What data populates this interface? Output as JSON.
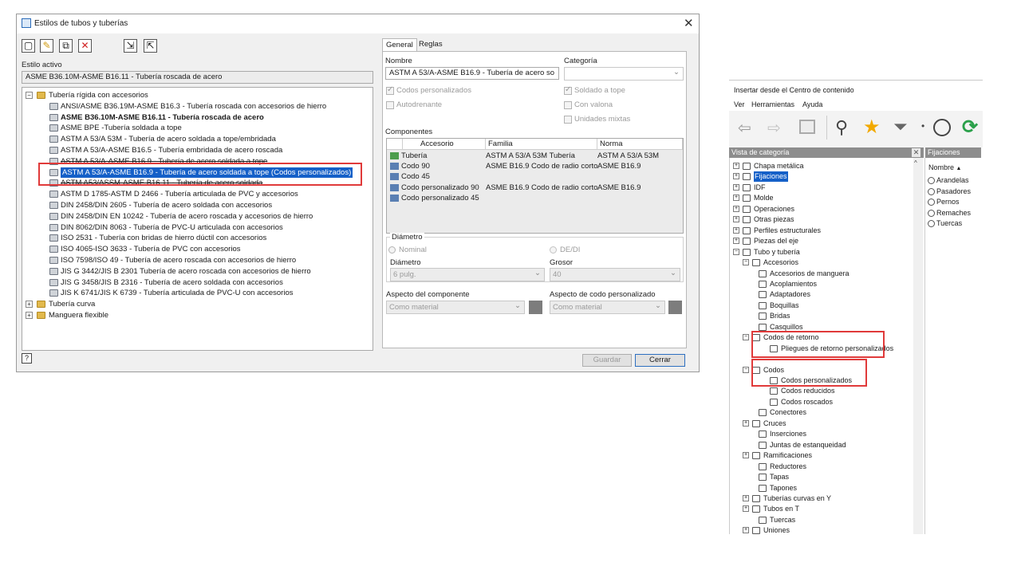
{
  "dialog": {
    "title": "Estilos de tubos y tuberías",
    "close": "✕",
    "toolbar_icons": [
      "new-icon",
      "edit-icon",
      "copy-icon",
      "delete-icon",
      "import-icon",
      "export-icon"
    ],
    "active_style_label": "Estilo activo",
    "active_style_value": "ASME B36.10M-ASME B16.11 - Tubería roscada de acero",
    "tree": {
      "root": "Tubería rígida con accesorios",
      "items": [
        "ANSI/ASME B36.19M-ASME B16.3 - Tubería roscada con accesorios de hierro",
        "ASME B36.10M-ASME B16.11 - Tubería roscada de acero",
        "ASME BPE -Tubería soldada a tope",
        "ASTM A 53/A 53M - Tubería de acero soldada a tope/embridada",
        "ASTM A 53/A-ASME B16.5 - Tubería embridada de acero roscada",
        "ASTM A 53/A-ASME B16.9 - Tubería de acero soldada a tope",
        "ASTM A 53/A-ASME B16.9 - Tubería de acero soldada a tope (Codos personalizados)",
        "ASTM A53/ASSM-ASME B16.11 - Tubería de acero soldada",
        "ASTM D 1785-ASTM D 2466 - Tubería articulada de PVC y accesorios",
        "DIN 2458/DIN 2605 - Tubería de acero soldada con accesorios",
        "DIN 2458/DIN EN 10242 - Tubería de acero roscada y accesorios de hierro",
        "DIN 8062/DIN 8063 - Tubería de PVC-U articulada con accesorios",
        "ISO 2531 - Tubería con bridas de hierro dúctil con accesorios",
        "ISO 4065-ISO 3633 - Tubería de PVC con accesorios",
        "ISO 7598/ISO 49 - Tubería de acero roscada con accesorios de hierro",
        "JIS G 3442/JIS B 2301 Tubería de acero roscada con accesorios de hierro",
        "JIS G 3458/JIS B 2316 - Tubería de acero soldada con accesorios",
        "JIS K 6741/JIS K 6739 - Tubería articulada de PVC-U con accesorios"
      ],
      "others": [
        "Tubería curva",
        "Manguera flexible"
      ]
    },
    "tabs": [
      "General",
      "Reglas"
    ],
    "nombre_label": "Nombre",
    "nombre_value": "ASTM A 53/A-ASME B16.9 - Tubería de acero so",
    "categoria_label": "Categoría",
    "check_codos": "Codos personalizados",
    "check_autodrenante": "Autodrenante",
    "check_soldado": "Soldado a tope",
    "check_valona": "Con valona",
    "check_mixtas": "Unidades mixtas",
    "componentes_label": "Componentes",
    "comp_headers": [
      "Accesorio",
      "Familia",
      "Norma"
    ],
    "comp_rows": [
      {
        "a": "Tubería",
        "f": "ASTM A 53/A 53M Tubería",
        "n": "ASTM A 53/A 53M"
      },
      {
        "a": "Codo 90",
        "f": "ASME B16.9 Codo de radio corto",
        "n": "ASME B16.9"
      },
      {
        "a": "Codo 45",
        "f": "",
        "n": ""
      },
      {
        "a": "Codo personalizado 90",
        "f": "ASME B16.9 Codo de radio corto",
        "n": "ASME B16.9"
      },
      {
        "a": "Codo personalizado 45",
        "f": "",
        "n": ""
      }
    ],
    "diametro_group": "Diámetro",
    "radio_nominal": "Nominal",
    "radio_dedi": "DE/DI",
    "diametro_label": "Diámetro",
    "diametro_value": "6 pulg.",
    "grosor_label": "Grosor",
    "grosor_value": "40",
    "aspecto_comp_label": "Aspecto del componente",
    "aspecto_comp_value": "Como material",
    "aspecto_codo_label": "Aspecto de codo personalizado",
    "aspecto_codo_value": "Como material",
    "btn_guardar": "Guardar",
    "btn_cerrar": "Cerrar"
  },
  "content_center": {
    "title": "Insertar desde el Centro de contenido",
    "menu": [
      "Ver",
      "Herramientas",
      "Ayuda"
    ],
    "toolbar_icons": [
      "back-arrow-icon",
      "forward-arrow-icon",
      "up-folder-icon",
      "search-icon",
      "favorites-star-icon",
      "filter-icon",
      "history-clock-icon",
      "refresh-icon"
    ],
    "category_header": "Vista de categoría",
    "right_header": "Fijaciones",
    "right_col": "Nombre",
    "right_items": [
      "Arandelas",
      "Pasadores",
      "Pernos",
      "Remaches",
      "Tuercas"
    ],
    "tree": [
      {
        "label": "Chapa metálica",
        "lvl": 0,
        "exp": "+"
      },
      {
        "label": "Fijaciones",
        "lvl": 0,
        "exp": "+",
        "sel": true
      },
      {
        "label": "IDF",
        "lvl": 0,
        "exp": "+"
      },
      {
        "label": "Molde",
        "lvl": 0,
        "exp": "+"
      },
      {
        "label": "Operaciones",
        "lvl": 0,
        "exp": "+"
      },
      {
        "label": "Otras piezas",
        "lvl": 0,
        "exp": "+"
      },
      {
        "label": "Perfiles estructurales",
        "lvl": 0,
        "exp": "+"
      },
      {
        "label": "Piezas del eje",
        "lvl": 0,
        "exp": "+"
      },
      {
        "label": "Tubo y tubería",
        "lvl": 0,
        "exp": "-"
      },
      {
        "label": "Accesorios",
        "lvl": 1,
        "exp": "-"
      },
      {
        "label": "Accesorios de manguera",
        "lvl": 2,
        "exp": ""
      },
      {
        "label": "Acoplamientos",
        "lvl": 2,
        "exp": ""
      },
      {
        "label": "Adaptadores",
        "lvl": 2,
        "exp": ""
      },
      {
        "label": "Boquillas",
        "lvl": 2,
        "exp": ""
      },
      {
        "label": "Bridas",
        "lvl": 2,
        "exp": ""
      },
      {
        "label": "Casquillos",
        "lvl": 2,
        "exp": ""
      },
      {
        "label": "Codos de retorno",
        "lvl": 1,
        "exp": "-"
      },
      {
        "label": "Pliegues de retorno personalizados",
        "lvl": 3,
        "exp": ""
      },
      {
        "label": "",
        "lvl": 2,
        "exp": ""
      },
      {
        "label": "Codos",
        "lvl": 1,
        "exp": "-"
      },
      {
        "label": "Codos personalizados",
        "lvl": 3,
        "exp": ""
      },
      {
        "label": "Codos reducidos",
        "lvl": 3,
        "exp": ""
      },
      {
        "label": "Codos roscados",
        "lvl": 3,
        "exp": ""
      },
      {
        "label": "Conectores",
        "lvl": 2,
        "exp": ""
      },
      {
        "label": "Cruces",
        "lvl": 1,
        "exp": "+"
      },
      {
        "label": "Inserciones",
        "lvl": 2,
        "exp": ""
      },
      {
        "label": "Juntas de estanqueidad",
        "lvl": 2,
        "exp": ""
      },
      {
        "label": "Ramificaciones",
        "lvl": 1,
        "exp": "+"
      },
      {
        "label": "Reductores",
        "lvl": 2,
        "exp": ""
      },
      {
        "label": "Tapas",
        "lvl": 2,
        "exp": ""
      },
      {
        "label": "Tapones",
        "lvl": 2,
        "exp": ""
      },
      {
        "label": "Tuberías curvas en Y",
        "lvl": 1,
        "exp": "+"
      },
      {
        "label": "Tubos en T",
        "lvl": 1,
        "exp": "+"
      },
      {
        "label": "Tuercas",
        "lvl": 2,
        "exp": ""
      },
      {
        "label": "Uniones",
        "lvl": 1,
        "exp": "+"
      }
    ]
  },
  "colors": {
    "selection": "#1560c8",
    "highlight_box": "#e03a3a",
    "star": "#f2a900",
    "refresh": "#2aa04a"
  }
}
